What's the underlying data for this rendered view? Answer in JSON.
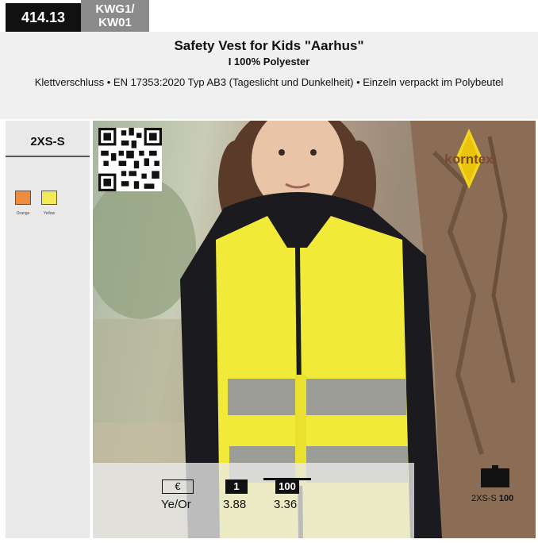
{
  "header": {
    "item_number": "414.13",
    "code_line1": "KWG1/",
    "code_line2": "KW01"
  },
  "product": {
    "title": "Safety Vest for Kids \"Aarhus\"",
    "subtitle": "I 100% Polyester",
    "features": "Klettverschluss • EN 17353:2020 Typ AB3 (Tageslicht und Dunkelheit) • Einzeln verpackt im Polybeutel"
  },
  "sidebar": {
    "size": "2XS-S",
    "colors": [
      {
        "label": "Orange",
        "hex": "#f08a3c"
      },
      {
        "label": "Yellow",
        "hex": "#f3ea57"
      }
    ]
  },
  "brand": {
    "name": "korntex"
  },
  "pricing": {
    "currency_symbol": "€",
    "color_code": "Ye/Or",
    "tier1_qty": "1",
    "tier1_price": "3.88",
    "tier2_qty": "100",
    "tier2_price": "3.36"
  },
  "carton": {
    "size": "2XS-S",
    "count": "100"
  },
  "icons": [
    "qr-code-icon",
    "carton-box-icon",
    "korntex-logo"
  ]
}
